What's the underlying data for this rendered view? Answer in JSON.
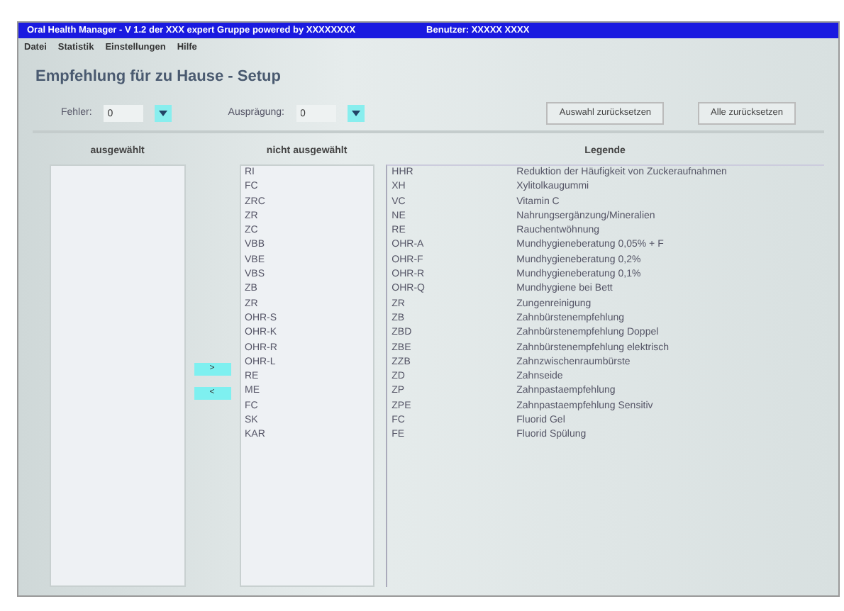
{
  "window": {
    "title": "Oral Health Manager - V 1.2 der XXX expert Gruppe powered by XXXXXXXX",
    "user": "Benutzer: XXXXX XXXX"
  },
  "menu": [
    "Datei",
    "Statistik",
    "Einstellungen",
    "Hilfe"
  ],
  "heading": "Empfehlung für zu Hause - Setup",
  "filters": [
    {
      "label": "Fehler:",
      "value": "0"
    },
    {
      "label": "Ausprägung:",
      "value": "0"
    }
  ],
  "buttons": [
    "Auswahl zurücksetzen",
    "Alle zurücksetzen"
  ],
  "selected": {
    "header": "ausgewählt"
  },
  "move_buttons": [
    ">",
    "<"
  ],
  "unselected": {
    "header": "nicht ausgewählt",
    "items": [
      "RI",
      "FC",
      "ZRC",
      "ZR",
      "ZC",
      "VBB",
      "VBE",
      "VBS",
      "ZB",
      "ZR",
      "OHR-S",
      "OHR-K",
      "OHR-R",
      "OHR-L",
      "RE",
      "ME",
      "FC",
      "SK",
      "KAR"
    ]
  },
  "legend": {
    "header": "Legende",
    "rows": [
      {
        "code": "HHR",
        "text": "Reduktion der Häufigkeit von Zuckeraufnahmen"
      },
      {
        "code": "XH",
        "text": "Xylitolkaugummi"
      },
      {
        "code": "VC",
        "text": "Vitamin C"
      },
      {
        "code": "NE",
        "text": "Nahrungsergänzung/Mineralien"
      },
      {
        "code": "RE",
        "text": "Rauchentwöhnung"
      },
      {
        "code": "OHR-A",
        "text": "Mundhygieneberatung 0,05% + F"
      },
      {
        "code": "OHR-F",
        "text": "Mundhygieneberatung 0,2%"
      },
      {
        "code": "OHR-R",
        "text": "Mundhygieneberatung 0,1%"
      },
      {
        "code": "OHR-Q",
        "text": "Mundhygiene bei Bett"
      },
      {
        "code": "ZR",
        "text": "Zungenreinigung"
      },
      {
        "code": "ZB",
        "text": "Zahnbürstenempfehlung"
      },
      {
        "code": "ZBD",
        "text": "Zahnbürstenempfehlung Doppel"
      },
      {
        "code": "ZBE",
        "text": "Zahnbürstenempfehlung elektrisch"
      },
      {
        "code": "ZZB",
        "text": "Zahnzwischenraumbürste"
      },
      {
        "code": "ZD",
        "text": "Zahnseide"
      },
      {
        "code": "ZP",
        "text": "Zahnpastaempfehlung"
      },
      {
        "code": "ZPE",
        "text": "Zahnpastaempfehlung Sensitiv"
      },
      {
        "code": "FC",
        "text": "Fluorid Gel"
      },
      {
        "code": "FE",
        "text": "Fluorid Spülung"
      }
    ]
  }
}
